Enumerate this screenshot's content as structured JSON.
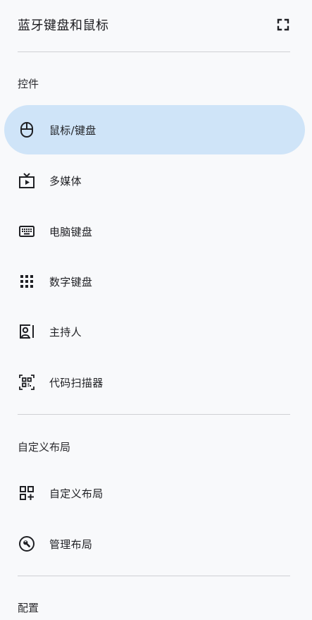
{
  "header": {
    "title": "蓝牙键盘和鼠标",
    "fullscreen_icon": "fullscreen-icon"
  },
  "sections": {
    "controls": {
      "title": "控件",
      "items": [
        {
          "label": "鼠标/键盘",
          "icon": "mouse-icon",
          "active": true
        },
        {
          "label": "多媒体",
          "icon": "tv-play-icon",
          "active": false
        },
        {
          "label": "电脑键盘",
          "icon": "keyboard-icon",
          "active": false
        },
        {
          "label": "数字键盘",
          "icon": "dialpad-icon",
          "active": false
        },
        {
          "label": "主持人",
          "icon": "presenter-icon",
          "active": false
        },
        {
          "label": "代码扫描器",
          "icon": "qr-scanner-icon",
          "active": false
        }
      ]
    },
    "custom_layout": {
      "title": "自定义布局",
      "items": [
        {
          "label": "自定义布局",
          "icon": "add-layout-icon",
          "active": false
        },
        {
          "label": "管理布局",
          "icon": "wrench-icon",
          "active": false
        }
      ]
    },
    "config": {
      "title": "配置"
    }
  },
  "colors": {
    "active_background": "#cfe4f8",
    "divider": "#cfd0d4",
    "text": "#1f2024",
    "icon": "#1f2024"
  }
}
